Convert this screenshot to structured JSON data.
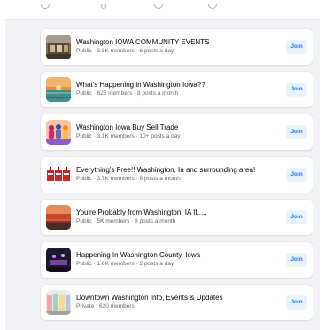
{
  "top_icons": [
    "chevron-icon",
    "dot-icon",
    "chevron-icon",
    "chevron-icon"
  ],
  "join_label": "Join",
  "groups": [
    {
      "name": "Washington IOWA COMMUNITY EVENTS",
      "meta": "Public · 3.8K members · 6 posts a day",
      "thumb": "storefront-photo"
    },
    {
      "name": "What's Happening in Washington Iowa??",
      "meta": "Public · 625 members · 8 posts a month",
      "thumb": "sunset-lake-photo"
    },
    {
      "name": "Washington Iowa Buy Sell Trade",
      "meta": "Public · 3.1K members · 10+ posts a day",
      "thumb": "people-crowd-photo"
    },
    {
      "name": "Everything's Free!! Washington, Ia and surrounding area!",
      "meta": "Public · 3.7K members · 8 posts a month",
      "thumb": "free-sign-photo"
    },
    {
      "name": "You're Probably from Washington, IA If.....",
      "meta": "Public · 5K members · 8 posts a month",
      "thumb": "orange-sky-photo"
    },
    {
      "name": "Happening In Washington County, Iowa",
      "meta": "Public · 1.6K members · 2 posts a day",
      "thumb": "night-stage-photo"
    },
    {
      "name": "Downtown Washington Info, Events & Updates",
      "meta": "Private · 620 members",
      "thumb": "downtown-street-photo"
    }
  ],
  "colors": {
    "background": "#f0f2f5",
    "card": "#ffffff",
    "join_bg": "#e7f3ff",
    "join_text": "#1b74e4",
    "title_text": "#050505",
    "meta_text": "#65676b"
  }
}
